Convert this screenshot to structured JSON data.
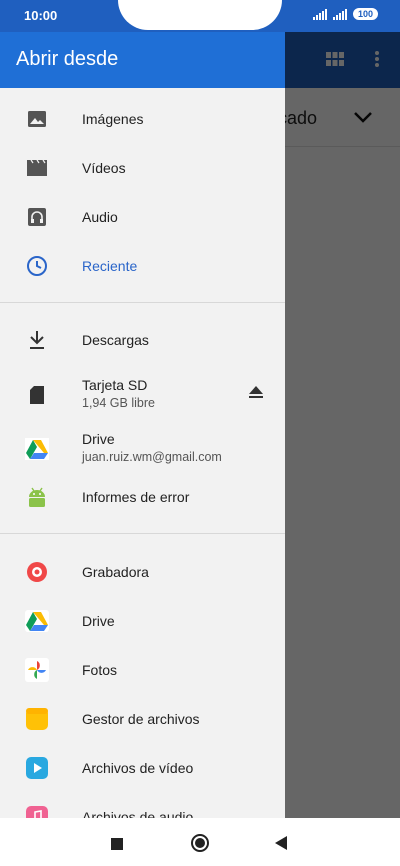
{
  "status_bar": {
    "time": "10:00",
    "battery": "100",
    "colors": {
      "bar": "#1f5fbf"
    }
  },
  "background_app": {
    "partial_title": "cado",
    "icons": [
      "grid-view-icon",
      "more-vert-icon",
      "chevron-down-icon"
    ]
  },
  "drawer": {
    "title": "Abrir desde",
    "colors": {
      "header": "#1f6fd6",
      "accent": "#2a65c9",
      "background": "#f2f2f2"
    },
    "section1": [
      {
        "label": "Imágenes",
        "icon": "image-icon"
      },
      {
        "label": "Vídeos",
        "icon": "video-icon"
      },
      {
        "label": "Audio",
        "icon": "headphones-icon"
      },
      {
        "label": "Reciente",
        "icon": "clock-icon",
        "selected": true
      }
    ],
    "section2": [
      {
        "label": "Descargas",
        "icon": "download-icon"
      },
      {
        "label": "Tarjeta SD",
        "sub": "1,94 GB libre",
        "icon": "sd-card-icon",
        "action_icon": "eject-icon"
      },
      {
        "label": "Drive",
        "sub": "juan.ruiz.wm@gmail.com",
        "icon": "google-drive-icon"
      },
      {
        "label": "Informes de error",
        "icon": "android-icon"
      }
    ],
    "section3": [
      {
        "label": "Grabadora",
        "icon": "recorder-icon"
      },
      {
        "label": "Drive",
        "icon": "google-drive-icon"
      },
      {
        "label": "Fotos",
        "icon": "google-photos-icon"
      },
      {
        "label": "Gestor de archivos",
        "icon": "file-manager-icon"
      },
      {
        "label": "Archivos de vídeo",
        "icon": "video-files-icon"
      },
      {
        "label": "Archivos de audio",
        "icon": "audio-files-icon"
      }
    ]
  },
  "nav_bar": {
    "icons": [
      "recents-icon",
      "home-icon",
      "back-icon"
    ]
  }
}
